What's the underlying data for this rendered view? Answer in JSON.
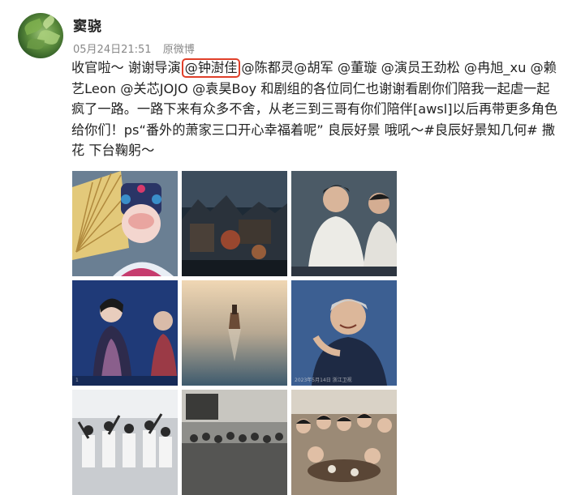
{
  "user": {
    "name": "窦骁"
  },
  "post": {
    "timestamp": "05月24日21:51",
    "source": "原微博",
    "text_segments": [
      {
        "type": "text",
        "value": "收官啦～ 谢谢导演"
      },
      {
        "type": "mention-highlighted",
        "value": "@钟澍佳"
      },
      {
        "type": "mention",
        "value": "@陈都灵"
      },
      {
        "type": "mention",
        "value": "@胡军"
      },
      {
        "type": "text",
        "value": " "
      },
      {
        "type": "mention",
        "value": "@董璇"
      },
      {
        "type": "text",
        "value": " "
      },
      {
        "type": "mention",
        "value": "@演员王劲松"
      },
      {
        "type": "text",
        "value": " "
      },
      {
        "type": "mention",
        "value": "@冉旭_xu"
      },
      {
        "type": "text",
        "value": " "
      },
      {
        "type": "mention",
        "value": "@赖艺Leon"
      },
      {
        "type": "text",
        "value": " "
      },
      {
        "type": "mention",
        "value": "@关芯JOJO"
      },
      {
        "type": "text",
        "value": " "
      },
      {
        "type": "mention",
        "value": "@袁昊Boy"
      },
      {
        "type": "text",
        "value": " 和剧组的各位同仁也谢谢看剧你们陪我一起虐一起疯了一路。一路下来有众多不舍，从老三到三哥有你们陪伴[awsl]以后再带更多角色给你们！ps“番外的萧家三口开心幸福着呢” 良辰好景 哦吼～"
      },
      {
        "type": "topic",
        "value": "#良辰好景知几何#"
      },
      {
        "type": "text",
        "value": " 撒花 下台鞠躬～"
      }
    ],
    "images": [
      {
        "name": "peking-opera-photo",
        "caption": ""
      },
      {
        "name": "ruined-city-photo",
        "caption": ""
      },
      {
        "name": "two-men-stage-photo",
        "caption": ""
      },
      {
        "name": "woman-qipao-photo",
        "caption": "1"
      },
      {
        "name": "ship-at-sea-photo",
        "caption": ""
      },
      {
        "name": "man-smiling-photo",
        "caption": "2023年5月14日 浙江卫视"
      },
      {
        "name": "crowd-dance-photo",
        "caption": ""
      },
      {
        "name": "old-crowd-photo",
        "caption": ""
      },
      {
        "name": "cast-dinner-photo",
        "caption": ""
      }
    ]
  },
  "colors": {
    "highlight_border": "#e0402a",
    "meta_gray": "#888888"
  }
}
